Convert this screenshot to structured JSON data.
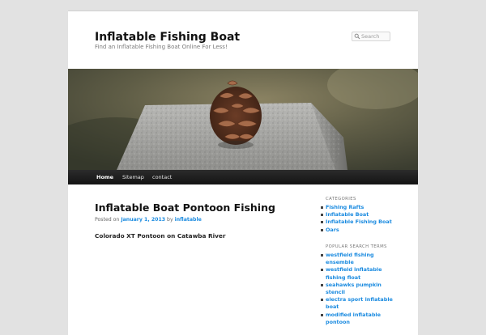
{
  "site": {
    "title": "Inflatable Fishing Boat",
    "description": "Find an Inflatable Fishing Boat Online For Less!"
  },
  "search": {
    "placeholder": "Search",
    "icon": "search-icon"
  },
  "nav": {
    "items": [
      {
        "label": "Home",
        "active": true
      },
      {
        "label": "Sitemap",
        "active": false
      },
      {
        "label": "contact",
        "active": false
      }
    ]
  },
  "header_image": {
    "subject": "pine cone on granite block"
  },
  "post": {
    "title": "Inflatable Boat Pontoon Fishing",
    "meta_prefix": "Posted on",
    "date": "January 1, 2013",
    "meta_by": "by",
    "author": "inflatable",
    "content": "Colorado XT Pontoon on Catawba River"
  },
  "sidebar": {
    "categories": {
      "title": "CATEGORIES",
      "items": [
        "Fishing Rafts",
        "Inflatable Boat",
        "Inflatable Fishing Boat",
        "Oars"
      ]
    },
    "popular": {
      "title": "POPULAR SEARCH TERMS",
      "items": [
        "westfield fishing ensemble",
        "westfield inflatable fishing float",
        "seahawks pumpkin stencil",
        "electra sport inflatable boat",
        "modified inflatable pontoon"
      ]
    }
  },
  "colors": {
    "link": "#1b8be0",
    "nav_bg": "#1f1f1f",
    "page_bg": "#e2e2e2"
  }
}
